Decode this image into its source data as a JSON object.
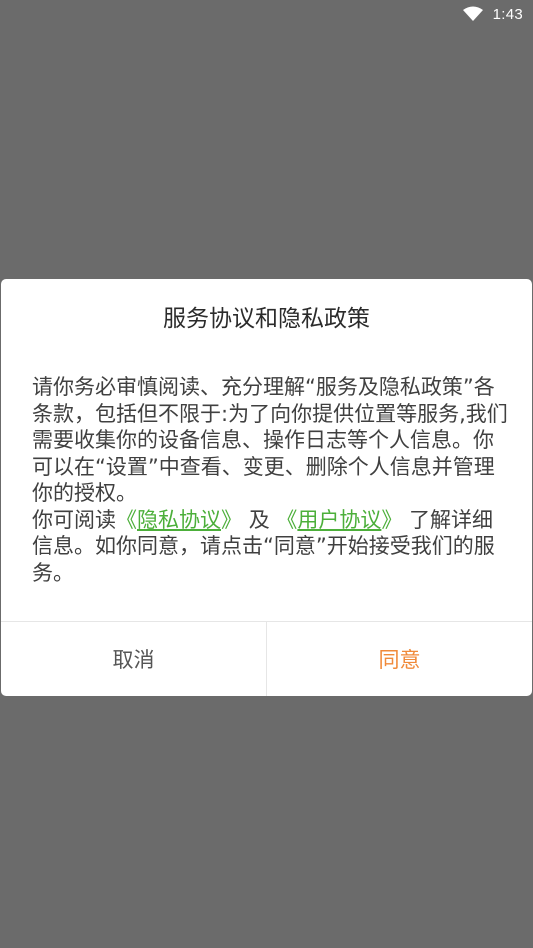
{
  "status_bar": {
    "time": "1:43",
    "icons": [
      "wifi-icon"
    ]
  },
  "dialog": {
    "title": "服务协议和隐私政策",
    "body": {
      "paragraph1": "请你务必审慎阅读、充分理解“服务及隐私政策”各条款，包括但不限于:为了向你提供位置等服务,我们需要收集你的设备信息、操作日志等个人信息。你可以在“设置”中查看、变更、删除个人信息并管理你的授权。",
      "p2_prefix": "你可阅读",
      "privacy_open": "《",
      "privacy_link": "隐私协议",
      "privacy_close": "》",
      "and": "及",
      "user_open": "《",
      "user_link": "用户协议",
      "user_close": "》",
      "p2_suffix": "了解详细信息。如你同意，请点击“同意”开始接受我们的服务。"
    },
    "buttons": {
      "cancel": "取消",
      "agree": "同意"
    }
  },
  "colors": {
    "backdrop": "#6b6b6b",
    "link": "#4caf3a",
    "agree": "#f08a3a",
    "cancel": "#555555"
  }
}
